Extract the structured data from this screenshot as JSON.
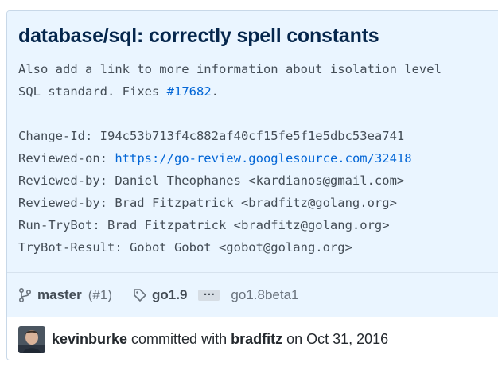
{
  "commit": {
    "title": "database/sql: correctly spell constants",
    "desc_line1": "Also add a link to more information about isolation level",
    "desc_line2_prefix": "SQL standard. ",
    "desc_fixes_word": "Fixes",
    "desc_space": " ",
    "desc_issue_link": "#17682",
    "desc_period": ".",
    "change_id_label": "Change-Id: ",
    "change_id_value": "I94c53b713f4c882af40cf15fe5f1e5dbc53ea741",
    "reviewed_on_label": "Reviewed-on: ",
    "reviewed_on_url": "https://go-review.googlesource.com/32418",
    "reviewed_by_1": "Reviewed-by: Daniel Theophanes <kardianos@gmail.com>",
    "reviewed_by_2": "Reviewed-by: Brad Fitzpatrick <bradfitz@golang.org>",
    "run_trybot": "Run-TryBot: Brad Fitzpatrick <bradfitz@golang.org>",
    "trybot_result": "TryBot-Result: Gobot Gobot <gobot@golang.org>"
  },
  "branches": {
    "branch_icon": "git-branch-icon",
    "branch": "master",
    "pr_ref": "(#1)",
    "tag_icon": "tag-icon",
    "tag": "go1.9",
    "ellipsis": "…",
    "tag_more": "go1.8beta1"
  },
  "meta": {
    "author": "kevinburke",
    "committed_with": "committed with",
    "committer": "bradfitz",
    "on": "on",
    "date": "Oct 31, 2016"
  },
  "colors": {
    "header_bg": "#eaf5ff",
    "title": "#05264c",
    "link": "#0366d6",
    "text": "#444d56",
    "muted": "#6a737d"
  }
}
